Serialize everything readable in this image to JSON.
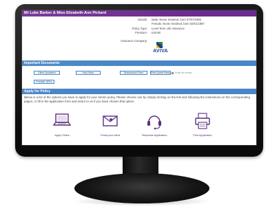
{
  "header": {
    "title": "Mr Luke Barber & Miss Elizabeth-Ann Pickard"
  },
  "details": {
    "rows": [
      {
        "label": "Details:",
        "value": "Male, Never Smoked, born 07/07/1986"
      },
      {
        "label": "",
        "value": "Female, Never Smoked, born 03/01/1987"
      },
      {
        "label": "Policy Type:",
        "value": "Level Term Life Insurance"
      },
      {
        "label": "Premium:",
        "value": "£20.88"
      },
      {
        "label": "Insurance Company:",
        "value": ""
      }
    ],
    "insurer_logo_text": "AVIVA"
  },
  "documents": {
    "heading": "Important Documents",
    "buttons": [
      "Client Quotation",
      "Key Facts",
      "Submission Form",
      "Print Quote Research",
      "Provider URLs"
    ],
    "email_label": "Email this version"
  },
  "apply": {
    "heading": "Apply for Policy",
    "intro": "Below is a list of the options you have to apply for your clients policy. Please choose one by simply clicking on the link and following the instructions on the corresponding pages, or fill in the application form and return to us if you have chosen that option.",
    "options": [
      {
        "label": "Apply Online",
        "icon": "laptop-icon"
      },
      {
        "label": "Email your client",
        "icon": "envelope-icon"
      },
      {
        "label": "Telephone Application",
        "icon": "headset-icon"
      },
      {
        "label": "Print Application",
        "icon": "printer-icon"
      }
    ]
  },
  "colors": {
    "header_purple": "#6b2a8f",
    "section_blue": "#4a86c5",
    "icon_purple": "#5b2d7e",
    "aviva_blue": "#1f3d8a"
  }
}
